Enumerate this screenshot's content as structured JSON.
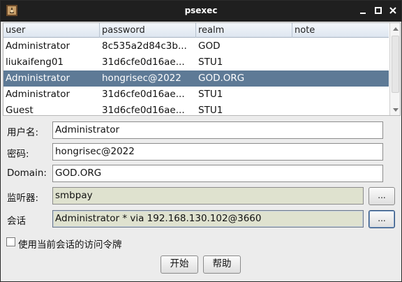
{
  "window": {
    "title": "psexec"
  },
  "table": {
    "columns": [
      "user",
      "password",
      "realm",
      "note"
    ],
    "rows": [
      {
        "user": "Administrator",
        "password": "8c535a2d84c3b...",
        "realm": "GOD",
        "note": ""
      },
      {
        "user": "liukaifeng01",
        "password": "31d6cfe0d16ae...",
        "realm": "STU1",
        "note": ""
      },
      {
        "user": "Administrator",
        "password": "hongrisec@2022",
        "realm": "GOD.ORG",
        "note": "",
        "selected": true
      },
      {
        "user": "Administrator",
        "password": "31d6cfe0d16ae...",
        "realm": "STU1",
        "note": ""
      },
      {
        "user": "Guest",
        "password": "31d6cfe0d16ae...",
        "realm": "STU1",
        "note": ""
      }
    ]
  },
  "form": {
    "username_label": "用户名:",
    "username_value": "Administrator",
    "password_label": "密码:",
    "password_value": "hongrisec@2022",
    "domain_label": "Domain:",
    "domain_value": "GOD.ORG",
    "listener_label": "监听器:",
    "listener_value": "smbpay",
    "session_label": "会话",
    "session_value": "Administrator * via  192.168.130.102@3660",
    "browse_label": "...",
    "use_token_label": "使用当前会话的访问令牌",
    "use_token_checked": false
  },
  "buttons": {
    "start": "开始",
    "help": "帮助"
  },
  "colors": {
    "titlebar": "#1f1f1f",
    "selected_row": "#5e7a96",
    "readonly_field": "#dfe2cf"
  }
}
